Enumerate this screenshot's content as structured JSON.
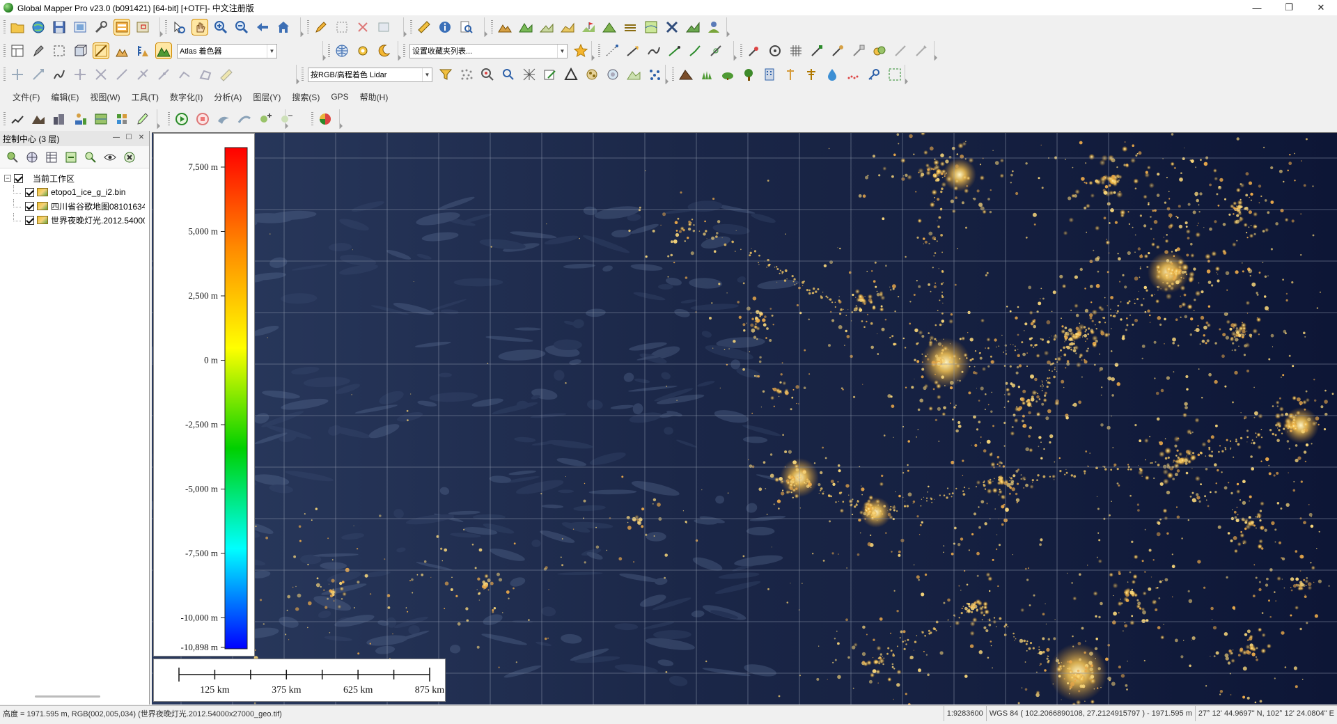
{
  "window": {
    "title": "Global Mapper Pro v23.0 (b091421) [64-bit] [+OTF]- 中文注册版",
    "controls": [
      "—",
      "❐",
      "✕"
    ]
  },
  "toolbar": {
    "shader_select": "Atlas 着色器",
    "favorites_select": "设置收藏夹列表...",
    "lidar_select": "按RGB/高程着色 Lidar"
  },
  "menu": [
    "文件(F)",
    "编辑(E)",
    "视图(W)",
    "工具(T)",
    "数字化(I)",
    "分析(A)",
    "图层(Y)",
    "搜索(S)",
    "GPS",
    "帮助(H)"
  ],
  "panel": {
    "title": "控制中心 (3 层)",
    "workspace": "当前工作区",
    "layers": [
      {
        "name": "etopo1_ice_g_i2.bin"
      },
      {
        "name": "四川省谷歌地图08101634"
      },
      {
        "name": "世界夜晚灯光.2012.54000"
      }
    ]
  },
  "legend": {
    "labels": [
      "7,500 m",
      "5,000 m",
      "2,500 m",
      "0 m",
      "-2,500 m",
      "-5,000 m",
      "-7,500 m",
      "-10,000 m",
      "-10,898 m"
    ],
    "colors": [
      "#ff0000",
      "#ff8a00",
      "#ffff00",
      "#00d000",
      "#00ffff",
      "#0000ff"
    ]
  },
  "scalebar": {
    "labels": [
      "125 km",
      "375 km",
      "625 km",
      "875 km"
    ]
  },
  "map": {
    "background": "#0d1636",
    "grid_color": "#8a93a8"
  },
  "status": {
    "left": "高度 = 1971.595 m, RGB(002,005,034) (世界夜晚灯光.2012.54000x27000_geo.tif)",
    "scale": "1:9283600",
    "coords": "WGS 84 ( 102.2066890108, 27.2124915797 ) - 1971.595 m",
    "dms": "27° 12' 44.9697\" N, 102° 12' 24.0804\" E"
  }
}
